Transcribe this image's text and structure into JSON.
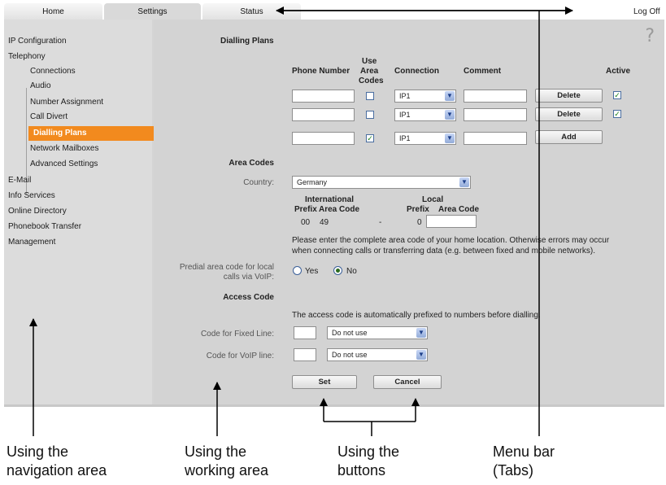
{
  "tabs": {
    "home": "Home",
    "settings": "Settings",
    "status": "Status",
    "logoff": "Log Off"
  },
  "help": "?",
  "nav": {
    "ip_config": "IP Configuration",
    "telephony": "Telephony",
    "sub": {
      "connections": "Connections",
      "audio": "Audio",
      "number_assignment": "Number Assignment",
      "call_divert": "Call Divert",
      "dialling_plans": "Dialling Plans",
      "network_mailboxes": "Network Mailboxes",
      "advanced_settings": "Advanced Settings"
    },
    "email": "E-Mail",
    "info_services": "Info Services",
    "online_directory": "Online Directory",
    "phonebook_transfer": "Phonebook Transfer",
    "management": "Management"
  },
  "dialling": {
    "section_title": "Dialling Plans",
    "headers": {
      "phone_number": "Phone Number",
      "use_area_1": "Use",
      "use_area_2": "Area",
      "use_area_3": "Codes",
      "connection": "Connection",
      "comment": "Comment",
      "active": "Active"
    },
    "rows": [
      {
        "connection": "IP1",
        "button": "Delete"
      },
      {
        "connection": "IP1",
        "button": "Delete"
      },
      {
        "connection": "IP1",
        "button": "Add"
      }
    ]
  },
  "area_codes": {
    "title": "Area Codes",
    "country_label": "Country:",
    "country_value": "Germany",
    "international": "International",
    "local": "Local",
    "prefix": "Prefix",
    "area_code": "Area Code",
    "intl_prefix": "00",
    "intl_area": "49",
    "dash": "-",
    "local_prefix": "0",
    "note_1": "Please enter the complete area code of your home location. Otherwise errors may occur",
    "note_2": "when connecting calls or transferring data (e.g. between fixed and mobile networks).",
    "predial_label_1": "Predial area code for local",
    "predial_label_2": "calls via VoIP:",
    "yes": "Yes",
    "no": "No"
  },
  "access": {
    "title": "Access Code",
    "note": "The access code is automatically prefixed to numbers before dialling.",
    "fixed_label": "Code for Fixed Line:",
    "voip_label": "Code for VoIP line:",
    "fixed_value": "Do not use",
    "voip_value": "Do not use"
  },
  "buttons": {
    "set": "Set",
    "cancel": "Cancel"
  },
  "callouts": {
    "nav_1": "Using the",
    "nav_2": "navigation area",
    "work_1": "Using the",
    "work_2": "working area",
    "btn_1": "Using the",
    "btn_2": "buttons",
    "menu_1": "Menu bar",
    "menu_2": "(Tabs)"
  }
}
